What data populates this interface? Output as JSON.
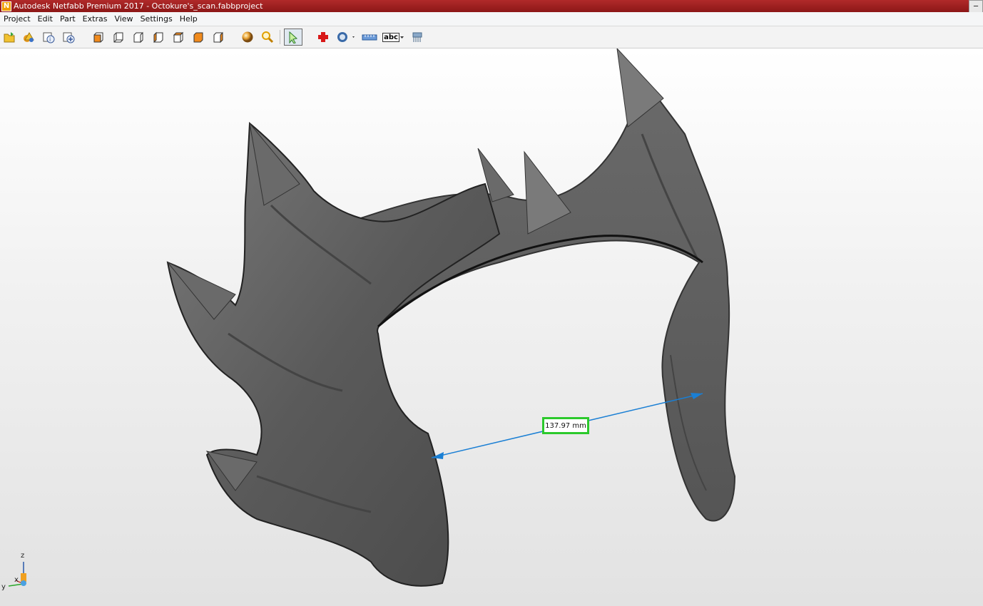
{
  "window": {
    "title": "Autodesk Netfabb Premium 2017 - Octokure's_scan.fabbproject",
    "logo_letter": "N"
  },
  "menu": [
    "Project",
    "Edit",
    "Part",
    "Extras",
    "View",
    "Settings",
    "Help"
  ],
  "toolbar": {
    "icons": [
      "open-project-icon",
      "add-part-icon",
      "part-info-icon",
      "add-part-plus-icon",
      "view-front-icon",
      "view-back-icon",
      "view-left-icon",
      "view-right-icon",
      "view-top-icon",
      "view-bottom-icon",
      "view-iso-icon",
      "sphere-shading-icon",
      "zoom-icon",
      "select-pointer-icon",
      "repair-cross-icon",
      "section-view-icon",
      "ruler-measure-icon",
      "text-label-icon",
      "support-icon"
    ],
    "text_tool_label": "abc"
  },
  "viewport": {
    "measurement": "137.97 mm",
    "axes": {
      "z": "z",
      "x": "x",
      "y": "y"
    },
    "colors": {
      "model": "#5f5f5f",
      "measure_line": "#1a7fd4",
      "label_border": "#2cc92c"
    }
  }
}
